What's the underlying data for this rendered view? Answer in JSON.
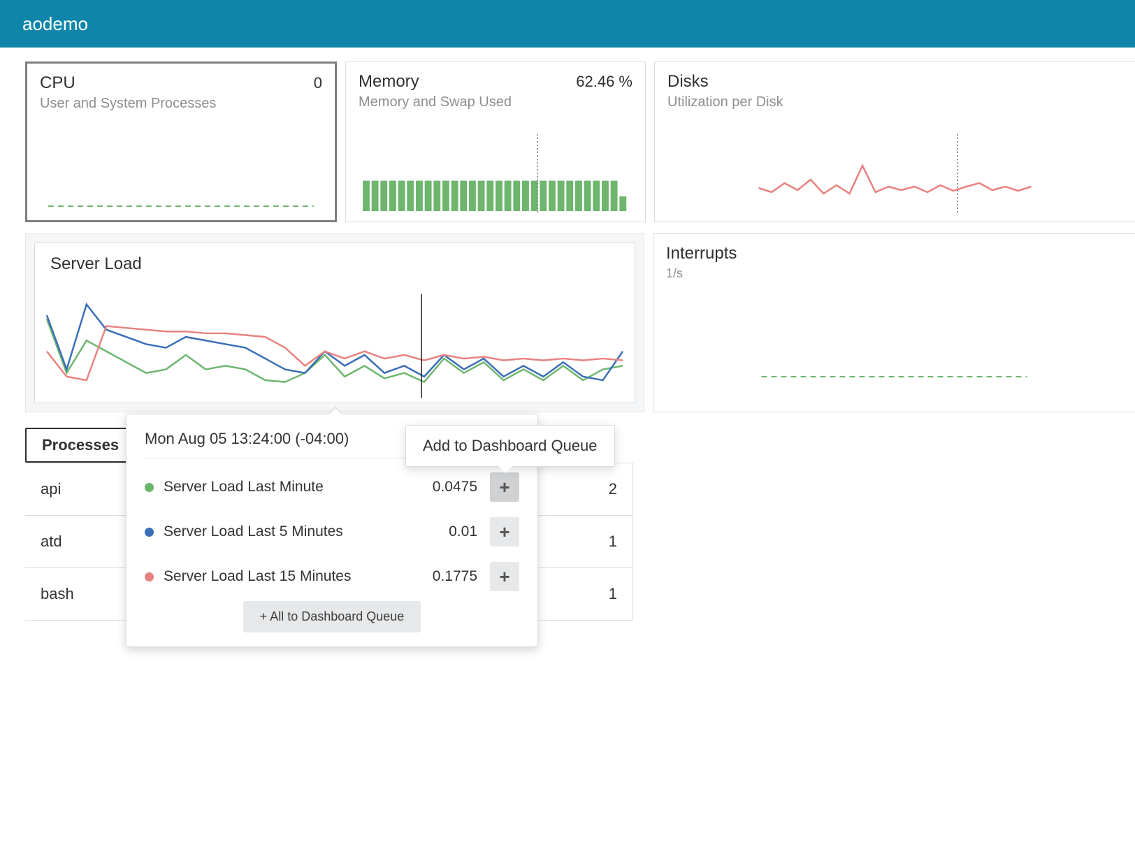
{
  "header": {
    "title": "aodemo"
  },
  "cards": {
    "cpu": {
      "title": "CPU",
      "metric": "0",
      "subtitle": "User and System Processes"
    },
    "memory": {
      "title": "Memory",
      "metric": "62.46 %",
      "subtitle": "Memory and Swap Used"
    },
    "disks": {
      "title": "Disks",
      "subtitle": "Utilization per Disk"
    },
    "load": {
      "title": "Server Load"
    },
    "interrupts": {
      "title": "Interrupts",
      "subtitle": "1/s"
    }
  },
  "tabs": {
    "processes": "Processes"
  },
  "processes": [
    {
      "name": "api",
      "count": "2"
    },
    {
      "name": "atd",
      "count": "1"
    },
    {
      "name": "bash",
      "count": "1"
    }
  ],
  "tooltip": {
    "timestamp": "Mon Aug 05 13:24:00 (-04:00)",
    "rows": [
      {
        "color": "#6eb66e",
        "label": "Server Load Last Minute",
        "value": "0.0475"
      },
      {
        "color": "#3a6fb7",
        "label": "Server Load Last 5 Minutes",
        "value": "0.01"
      },
      {
        "color": "#e9827f",
        "label": "Server Load Last 15 Minutes",
        "value": "0.1775"
      }
    ],
    "addAll": "+ All to Dashboard Queue",
    "tipText": "Add to Dashboard Queue",
    "plus": "+"
  },
  "chart_data": [
    {
      "type": "line",
      "title": "CPU",
      "series": [
        {
          "name": "cpu",
          "values": [
            0,
            0,
            0,
            0,
            0,
            0,
            0,
            0,
            0,
            0,
            0,
            0,
            0,
            0,
            0,
            0,
            0,
            0,
            0,
            0,
            0,
            0,
            0,
            0,
            0,
            0,
            0,
            0,
            0,
            0
          ]
        }
      ],
      "ylim": [
        0,
        100
      ]
    },
    {
      "type": "bar",
      "title": "Memory",
      "values": [
        62,
        62,
        62,
        62,
        62,
        62,
        62,
        62,
        62,
        62,
        62,
        62,
        62,
        62,
        62,
        62,
        62,
        62,
        62,
        62,
        62,
        62,
        62,
        62,
        62,
        62,
        62,
        62,
        62,
        30
      ],
      "ylim": [
        0,
        100
      ],
      "color": "#6eb66e"
    },
    {
      "type": "line",
      "title": "Disks",
      "series": [
        {
          "name": "disk",
          "values": [
            28,
            22,
            35,
            25,
            40,
            20,
            32,
            20,
            60,
            22,
            30,
            25,
            30,
            22,
            32,
            24,
            30,
            35,
            25,
            30,
            24,
            30
          ]
        }
      ],
      "ylim": [
        0,
        100
      ],
      "color": "#e9827f"
    },
    {
      "type": "line",
      "title": "Server Load",
      "x": [
        0,
        1,
        2,
        3,
        4,
        5,
        6,
        7,
        8,
        9,
        10,
        11,
        12,
        13,
        14,
        15,
        16,
        17,
        18,
        19,
        20,
        21,
        22,
        23,
        24,
        25,
        26,
        27,
        28,
        29
      ],
      "series": [
        {
          "name": "Server Load Last Minute",
          "color": "#6eb66e",
          "values": [
            0.4,
            0.1,
            0.28,
            0.22,
            0.16,
            0.1,
            0.12,
            0.2,
            0.12,
            0.14,
            0.12,
            0.06,
            0.05,
            0.1,
            0.2,
            0.08,
            0.14,
            0.07,
            0.1,
            0.05,
            0.18,
            0.1,
            0.16,
            0.06,
            0.12,
            0.06,
            0.14,
            0.06,
            0.12,
            0.14
          ]
        },
        {
          "name": "Server Load Last 5 Minutes",
          "color": "#3a6fb7",
          "values": [
            0.42,
            0.12,
            0.48,
            0.34,
            0.3,
            0.26,
            0.24,
            0.3,
            0.28,
            0.26,
            0.24,
            0.18,
            0.12,
            0.1,
            0.22,
            0.14,
            0.2,
            0.1,
            0.14,
            0.08,
            0.2,
            0.12,
            0.18,
            0.08,
            0.14,
            0.08,
            0.16,
            0.08,
            0.06,
            0.22
          ]
        },
        {
          "name": "Server Load Last 15 Minutes",
          "color": "#e9827f",
          "values": [
            0.22,
            0.08,
            0.06,
            0.36,
            0.35,
            0.34,
            0.33,
            0.33,
            0.32,
            0.32,
            0.31,
            0.3,
            0.24,
            0.14,
            0.22,
            0.18,
            0.22,
            0.18,
            0.2,
            0.17,
            0.2,
            0.18,
            0.19,
            0.17,
            0.18,
            0.17,
            0.18,
            0.17,
            0.18,
            0.17
          ]
        }
      ],
      "ylim": [
        0,
        0.5
      ]
    },
    {
      "type": "line",
      "title": "Interrupts",
      "series": [
        {
          "name": "interrupts",
          "values": [
            1,
            1,
            1,
            1,
            1,
            1,
            1,
            1,
            1,
            1,
            1,
            1,
            1,
            1,
            1,
            1,
            1,
            1,
            1,
            1,
            1,
            1,
            1,
            1,
            1,
            1,
            1,
            1
          ]
        }
      ],
      "ylim": [
        0,
        10
      ],
      "color": "#6eb66e"
    }
  ]
}
